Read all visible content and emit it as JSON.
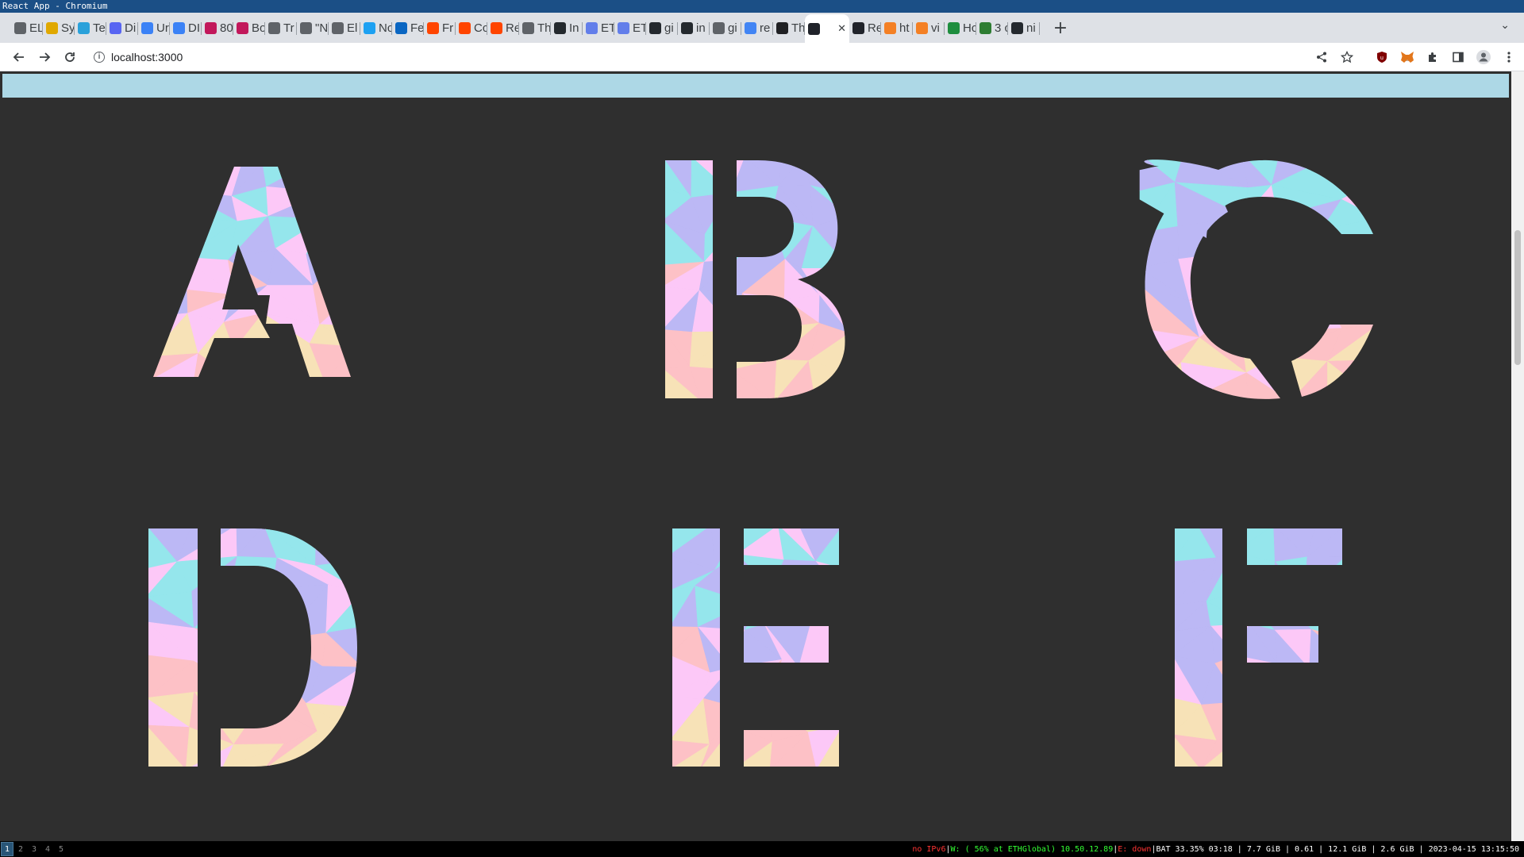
{
  "window": {
    "title": "React App - Chromium"
  },
  "tabs": [
    {
      "label": "EL",
      "icon": "globe-icon",
      "color": "#5f6368"
    },
    {
      "label": "Sy",
      "icon": "bird-icon",
      "color": "#e0a800"
    },
    {
      "label": "Te",
      "icon": "telegram-icon",
      "color": "#2aa1da"
    },
    {
      "label": "Di",
      "icon": "discord-icon",
      "color": "#5865f2"
    },
    {
      "label": "Ur",
      "icon": "app-icon",
      "color": "#3b82f6"
    },
    {
      "label": "DI",
      "icon": "app-icon",
      "color": "#3b82f6"
    },
    {
      "label": "80",
      "icon": "jr-icon",
      "color": "#c2185b"
    },
    {
      "label": "Bo",
      "icon": "jr-icon",
      "color": "#c2185b"
    },
    {
      "label": "Tr",
      "icon": "globe-icon",
      "color": "#5f6368"
    },
    {
      "label": "\"N",
      "icon": "doc-icon",
      "color": "#5f6368"
    },
    {
      "label": "El",
      "icon": "doc-icon",
      "color": "#5f6368"
    },
    {
      "label": "Nc",
      "icon": "twitter-icon",
      "color": "#1da1f2"
    },
    {
      "label": "Fe",
      "icon": "linkedin-icon",
      "color": "#0a66c2"
    },
    {
      "label": "Fr",
      "icon": "reddit-icon",
      "color": "#ff4500"
    },
    {
      "label": "Cc",
      "icon": "reddit-icon",
      "color": "#ff4500"
    },
    {
      "label": "Re",
      "icon": "reddit-icon",
      "color": "#ff4500"
    },
    {
      "label": "Th",
      "icon": "globe-icon",
      "color": "#5f6368"
    },
    {
      "label": "In",
      "icon": "github-icon",
      "color": "#24292e"
    },
    {
      "label": "ET",
      "icon": "eth-icon",
      "color": "#627eea"
    },
    {
      "label": "ET",
      "icon": "eth-icon",
      "color": "#627eea"
    },
    {
      "label": "gi",
      "icon": "github-icon",
      "color": "#24292e"
    },
    {
      "label": "in",
      "icon": "github-icon",
      "color": "#24292e"
    },
    {
      "label": "gi",
      "icon": "globe-icon",
      "color": "#5f6368"
    },
    {
      "label": "re",
      "icon": "google-icon",
      "color": "#4285f4"
    },
    {
      "label": "Th",
      "icon": "letter-a-icon",
      "color": "#202124"
    },
    {
      "label": "",
      "icon": "react-icon",
      "color": "#20232a",
      "active": true
    },
    {
      "label": "Re",
      "icon": "react-icon",
      "color": "#20232a"
    },
    {
      "label": "ht",
      "icon": "stackoverflow-icon",
      "color": "#f48024"
    },
    {
      "label": "vi",
      "icon": "stackoverflow-icon",
      "color": "#f48024"
    },
    {
      "label": "Hc",
      "icon": "w-icon",
      "color": "#1e8e3e"
    },
    {
      "label": "3 c",
      "icon": "hat-icon",
      "color": "#2e7d32"
    },
    {
      "label": "ni",
      "icon": "github-icon",
      "color": "#24292e"
    }
  ],
  "toolbar": {
    "url": "localhost:3000"
  },
  "letters": [
    {
      "char": "A"
    },
    {
      "char": "B"
    },
    {
      "char": "C"
    },
    {
      "char": "D"
    },
    {
      "char": "E"
    },
    {
      "char": "F"
    }
  ],
  "palette": [
    "#95e6ec",
    "#bcb8f5",
    "#fcc8f7",
    "#fdc1c6",
    "#f7e2b7"
  ],
  "statusbar": {
    "workspaces": [
      "1",
      "2",
      "3",
      "4",
      "5"
    ],
    "ipv6": "no IPv6",
    "wifi": "W: ( 56% at ETHGlobal) 10.50.12.89",
    "eth": "E: down",
    "rest": "BAT 33.35% 03:18 | 7.7 GiB | 0.61 | 12.1 GiB | 2.6 GiB | 2023-04-15 13:15:50"
  }
}
